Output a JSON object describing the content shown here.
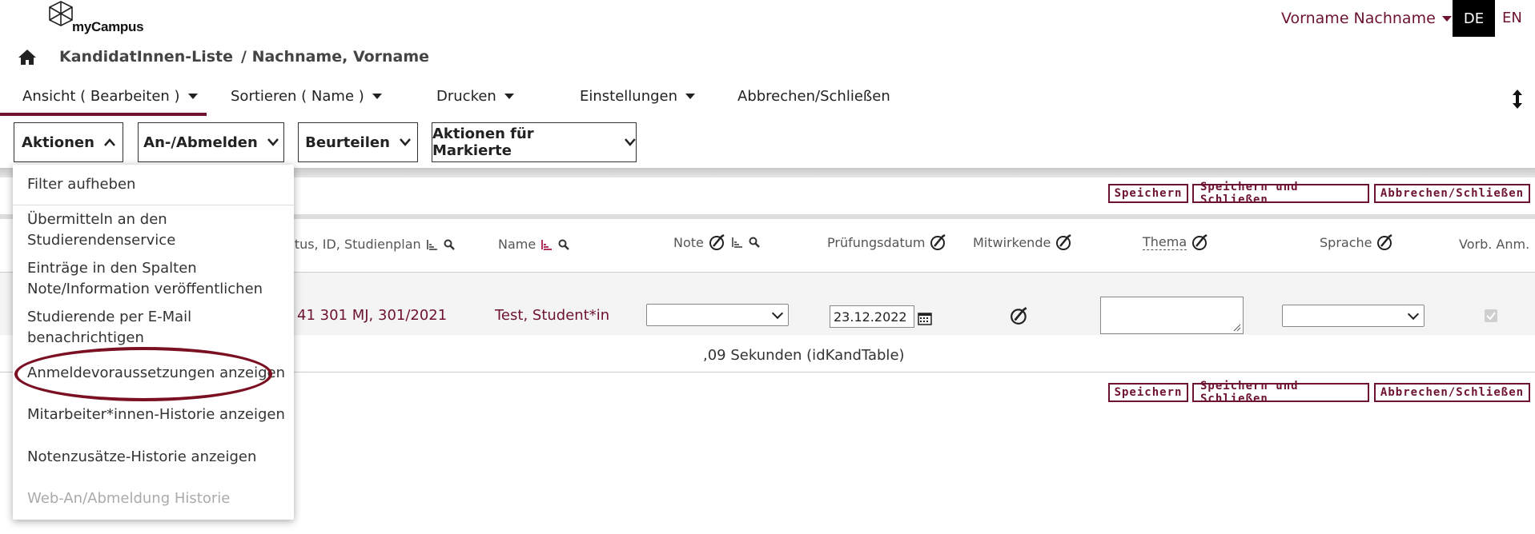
{
  "header": {
    "logo_text": "myCampus",
    "user_name": "Vorname Nachname",
    "lang_de": "DE",
    "lang_en": "EN"
  },
  "breadcrumb": {
    "list": "KandidatInnen-Liste",
    "current": "/ Nachname, Vorname"
  },
  "tabs": [
    {
      "label": "Ansicht ( Bearbeiten )",
      "active": true
    },
    {
      "label": "Sortieren ( Name )"
    },
    {
      "label": "Drucken"
    },
    {
      "label": "Einstellungen"
    },
    {
      "label": "Abbrechen/Schließen"
    }
  ],
  "actions": [
    {
      "label": "Aktionen",
      "open": true
    },
    {
      "label": "An-/Abmelden"
    },
    {
      "label": "Beurteilen"
    },
    {
      "label": "Aktionen für Markierte"
    }
  ],
  "save_buttons": {
    "save": "Speichern",
    "save_close": "Speichern und Schließen",
    "cancel_close": "Abbrechen/Schließen"
  },
  "table": {
    "headers": {
      "status": "atus, ID, Studienplan",
      "name": "Name",
      "note": "Note",
      "date": "Prüfungsdatum",
      "mitwirkende": "Mitwirkende",
      "thema": "Thema",
      "sprache": "Sprache",
      "vorb": "Vorb. Anm."
    },
    "row": {
      "status_id": "41 301 MJ, 301/2021",
      "name": "Test, Student*in",
      "date": "23.12.2022",
      "vorb_checked": true
    },
    "footer": ",09 Sekunden (idKandTable)"
  },
  "dropdown": {
    "items": [
      {
        "label": "Filter aufheben"
      },
      {
        "label_line1": "Übermitteln an den",
        "label_line2": "Studierendenservice"
      },
      {
        "label_line1": "Einträge in den Spalten",
        "label_line2": "Note/Information veröffentlichen"
      },
      {
        "label_line1": "Studierende per E-Mail",
        "label_line2": "benachrichtigen"
      },
      {
        "label": "Anmeldevoraussetzungen anzeigen",
        "highlighted": true
      },
      {
        "label": "Mitarbeiter*innen-Historie anzeigen"
      },
      {
        "label": "Notenzusätze-Historie anzeigen"
      },
      {
        "label": "Web-An/Abmeldung Historie",
        "disabled": true
      }
    ]
  },
  "colors": {
    "accent": "#6d1232",
    "highlight": "#7a1022"
  }
}
